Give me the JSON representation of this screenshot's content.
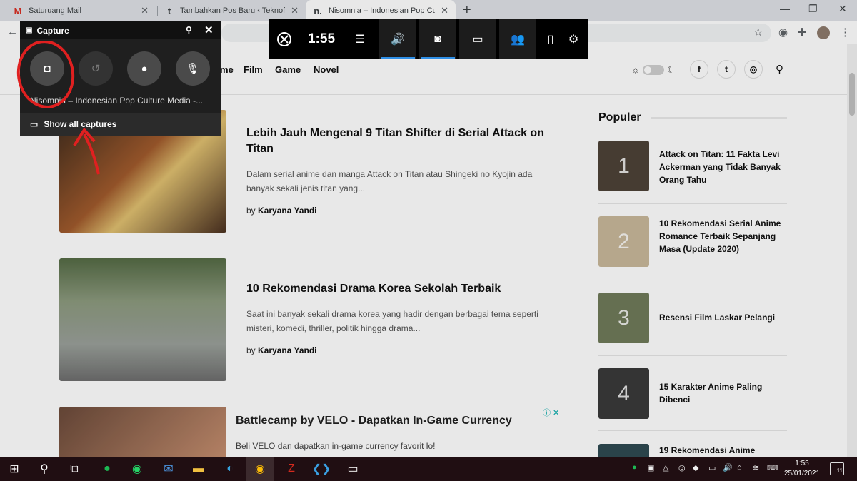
{
  "browser": {
    "tabs": [
      {
        "favicon": "M",
        "title": "Saturuang Mail"
      },
      {
        "favicon": "t",
        "title": "Tambahkan Pos Baru ‹ Teknofara"
      },
      {
        "favicon": "n.",
        "title": "Nisomnia – Indonesian Pop Cultu"
      }
    ],
    "new_tab": "+",
    "window_controls": [
      "—",
      "❐",
      "✕"
    ]
  },
  "site": {
    "nav": [
      "me",
      "Film",
      "Game",
      "Novel"
    ],
    "social": [
      "f",
      "t",
      "◎"
    ],
    "articles": [
      {
        "title": "Lebih Jauh Mengenal 9 Titan Shifter di Serial Attack on Titan",
        "excerpt": "Dalam serial anime dan manga Attack on Titan atau Shingeki no Kyojin ada banyak sekali jenis titan yang...",
        "by_prefix": "by",
        "author": "Karyana Yandi",
        "image_color": "#7a4a2a"
      },
      {
        "title": "10 Rekomendasi Drama Korea Sekolah Terbaik",
        "excerpt": "Saat ini banyak sekali drama korea yang hadir dengan berbagai tema seperti misteri, komedi, thriller, politik hingga drama...",
        "by_prefix": "by",
        "author": "Karyana Yandi",
        "image_color": "#8b8f88"
      }
    ],
    "ad": {
      "title": "Battlecamp by VELO - Dapatkan In-Game Currency",
      "description": "Beli VELO dan dapatkan in-game currency favorit lo!",
      "close": "ⓘ ✕"
    },
    "popular": {
      "heading": "Populer",
      "items": [
        {
          "rank": "1",
          "title": "Attack on Titan: 11 Fakta Levi Ackerman yang Tidak Banyak Orang Tahu",
          "color": "#4d4238"
        },
        {
          "rank": "2",
          "title": "10 Rekomendasi Serial Anime Romance Terbaik Sepanjang Masa (Update 2020)",
          "color": "#c9b89a"
        },
        {
          "rank": "3",
          "title": "Resensi Film Laskar Pelangi",
          "color": "#6f7a5a"
        },
        {
          "rank": "4",
          "title": "15 Karakter Anime Paling Dibenci",
          "color": "#3a3a3a"
        },
        {
          "rank": "",
          "title": "19 Rekomendasi Anime",
          "color": "#2f4a52"
        }
      ]
    }
  },
  "gamebar": {
    "time": "1:55",
    "capture": {
      "title": "Capture",
      "window_name": "Nisomnia – Indonesian Pop Culture Media -...",
      "show_all": "Show all captures"
    }
  },
  "taskbar": {
    "time": "1:55",
    "date": "25/01/2021",
    "notifications": "11"
  }
}
